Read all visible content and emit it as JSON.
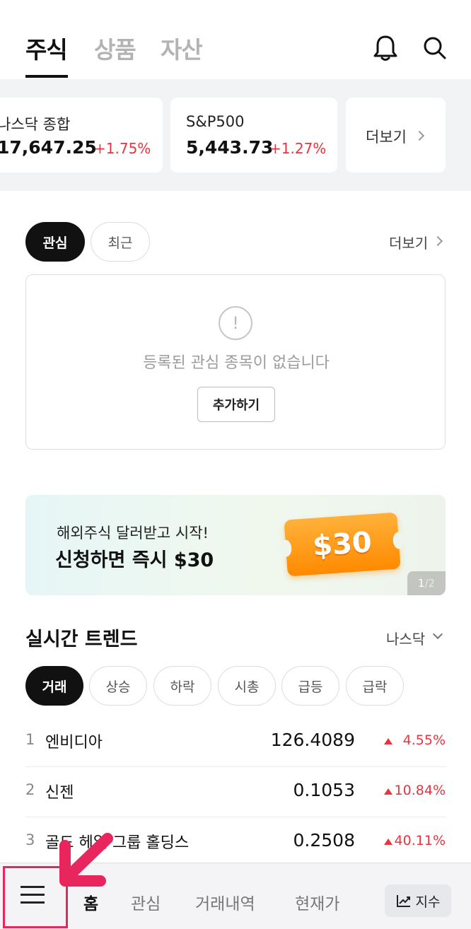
{
  "top_tabs": [
    {
      "label": "주식"
    },
    {
      "label": "상품"
    },
    {
      "label": "자산"
    }
  ],
  "icons": {
    "bell": "bell-icon",
    "search": "search-icon"
  },
  "indices": [
    {
      "name": "나스닥 종합",
      "value": "17,647.25",
      "change": "+1.75%"
    },
    {
      "name": "S&P500",
      "value": "5,443.73",
      "change": "+1.27%"
    }
  ],
  "indices_more": "더보기",
  "watchlist": {
    "tabs": [
      {
        "label": "관심"
      },
      {
        "label": "최근"
      }
    ],
    "more": "더보기",
    "empty_icon": "!",
    "empty_message": "등록된 관심 종목이 없습니다",
    "add_button": "추가하기"
  },
  "banner": {
    "subtitle": "해외주식 달러받고 시작!",
    "title": "신청하면 즉시 $30",
    "coupon": "$30",
    "page_current": "1",
    "page_total": "/2"
  },
  "trends": {
    "title": "실시간 트렌드",
    "market": "나스닥",
    "filters": [
      {
        "label": "거래"
      },
      {
        "label": "상승"
      },
      {
        "label": "하락"
      },
      {
        "label": "시총"
      },
      {
        "label": "급등"
      },
      {
        "label": "급락"
      }
    ],
    "rows": [
      {
        "rank": "1",
        "name": "엔비디아",
        "price": "126.4089",
        "change": "4.55%"
      },
      {
        "rank": "2",
        "name": "신젠",
        "price": "0.1053",
        "change": "10.84%"
      },
      {
        "rank": "3",
        "name": "골드 헤일 그룹 홀딩스",
        "price": "0.2508",
        "change": "40.11%"
      }
    ]
  },
  "bottom_nav": {
    "items": [
      {
        "label": "홈"
      },
      {
        "label": "관심"
      },
      {
        "label": "거래내역"
      },
      {
        "label": "현재가"
      }
    ],
    "index_button": "지수"
  },
  "colors": {
    "up": "#e8343e",
    "highlight": "#e8255c",
    "accent_coupon": "#ff8a00"
  }
}
